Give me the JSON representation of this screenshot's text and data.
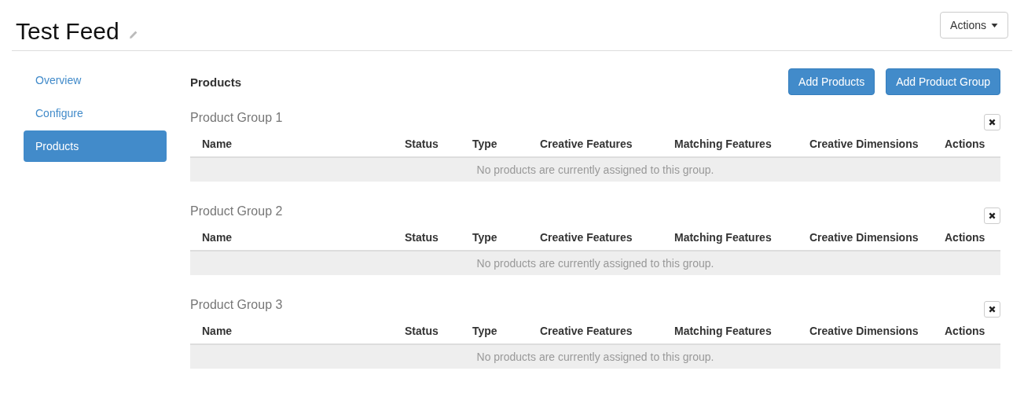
{
  "page": {
    "title": "Test Feed",
    "actions_button": "Actions"
  },
  "sidebar": {
    "items": [
      {
        "label": "Overview",
        "selected": false
      },
      {
        "label": "Configure",
        "selected": false
      },
      {
        "label": "Products",
        "selected": true
      }
    ]
  },
  "section": {
    "title": "Products",
    "buttons": [
      "Add Products",
      "Add Product Group"
    ]
  },
  "groups": [
    {
      "title": "Product Group 1",
      "columns": [
        "Name",
        "Status",
        "Type",
        "Creative Features",
        "Matching Features",
        "Creative Dimensions",
        "Actions"
      ],
      "empty_message": "No products are currently assigned to this group."
    },
    {
      "title": "Product Group 2",
      "columns": [
        "Name",
        "Status",
        "Type",
        "Creative Features",
        "Matching Features",
        "Creative Dimensions",
        "Actions"
      ],
      "empty_message": "No products are currently assigned to this group."
    },
    {
      "title": "Product Group 3",
      "columns": [
        "Name",
        "Status",
        "Type",
        "Creative Features",
        "Matching Features",
        "Creative Dimensions",
        "Actions"
      ],
      "empty_message": "No products are currently assigned to this group."
    }
  ]
}
